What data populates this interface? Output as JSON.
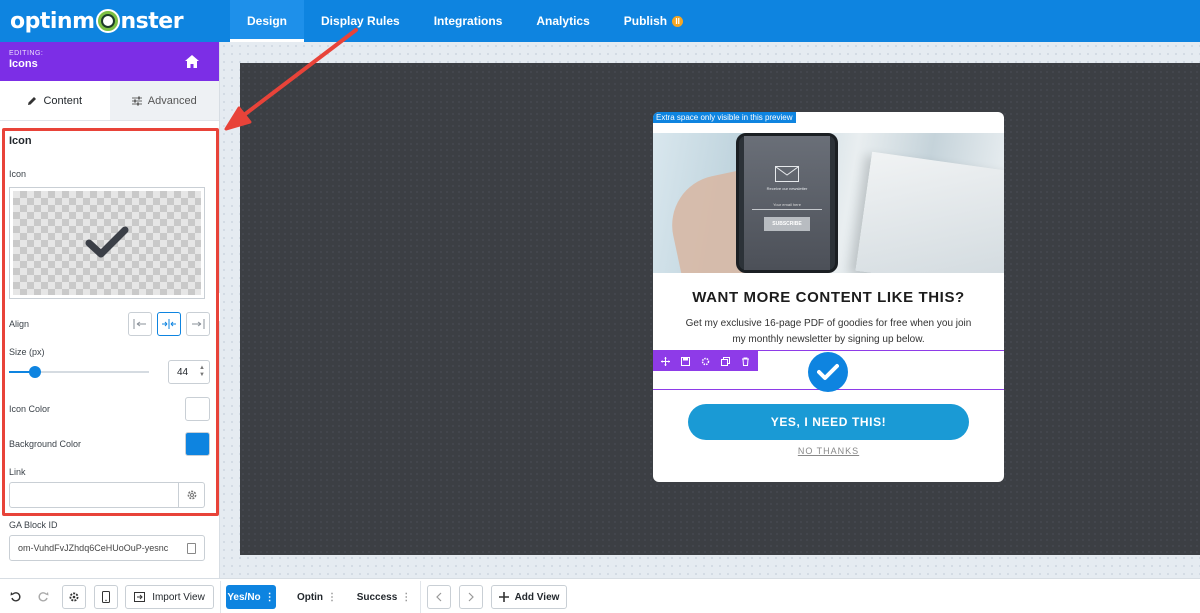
{
  "brand": {
    "logo_text_left": "optinm",
    "logo_text_right": "nster"
  },
  "nav": {
    "items": [
      {
        "label": "Design",
        "active": true
      },
      {
        "label": "Display Rules"
      },
      {
        "label": "Integrations"
      },
      {
        "label": "Analytics"
      },
      {
        "label": "Publish"
      }
    ]
  },
  "sidebar": {
    "editing_label": "EDITING:",
    "editing_name": "Icons",
    "tabs": [
      {
        "label": "Content",
        "active": true
      },
      {
        "label": "Advanced"
      }
    ],
    "section_title": "Icon",
    "icon_label": "Icon",
    "align_label": "Align",
    "align_selected": "center",
    "size_label": "Size (px)",
    "size_value": "44",
    "size_fraction": 0.16,
    "icon_color_label": "Icon Color",
    "icon_color": "#ffffff",
    "bg_color_label": "Background Color",
    "bg_color": "#0e84e0",
    "link_label": "Link",
    "link_value": "",
    "ga_label": "GA Block ID",
    "ga_value": "om-VuhdFvJZhdq6CeHUoOuP-yesnc"
  },
  "popup": {
    "extra_note": "Extra space only visible in this preview",
    "phone_text": "Receive our newsletter",
    "phone_field": "Your email here",
    "phone_button": "SUBSCRIBE",
    "headline": "WANT MORE CONTENT LIKE THIS?",
    "body": "Get my exclusive 16-page PDF of goodies for free when you join my monthly newsletter by signing up below.",
    "cta": "YES, I NEED THIS!",
    "no_thanks": "NO THANKS"
  },
  "bottom": {
    "import_view": "Import View",
    "views": [
      {
        "label": "Yes/No",
        "active": true
      },
      {
        "label": "Optin"
      },
      {
        "label": "Success"
      }
    ],
    "add_view": "Add View"
  },
  "colors": {
    "brand_blue": "#0e84e0",
    "purple": "#7c2ee6",
    "highlight_red": "#e84339",
    "cta_blue": "#1a9ad5"
  }
}
